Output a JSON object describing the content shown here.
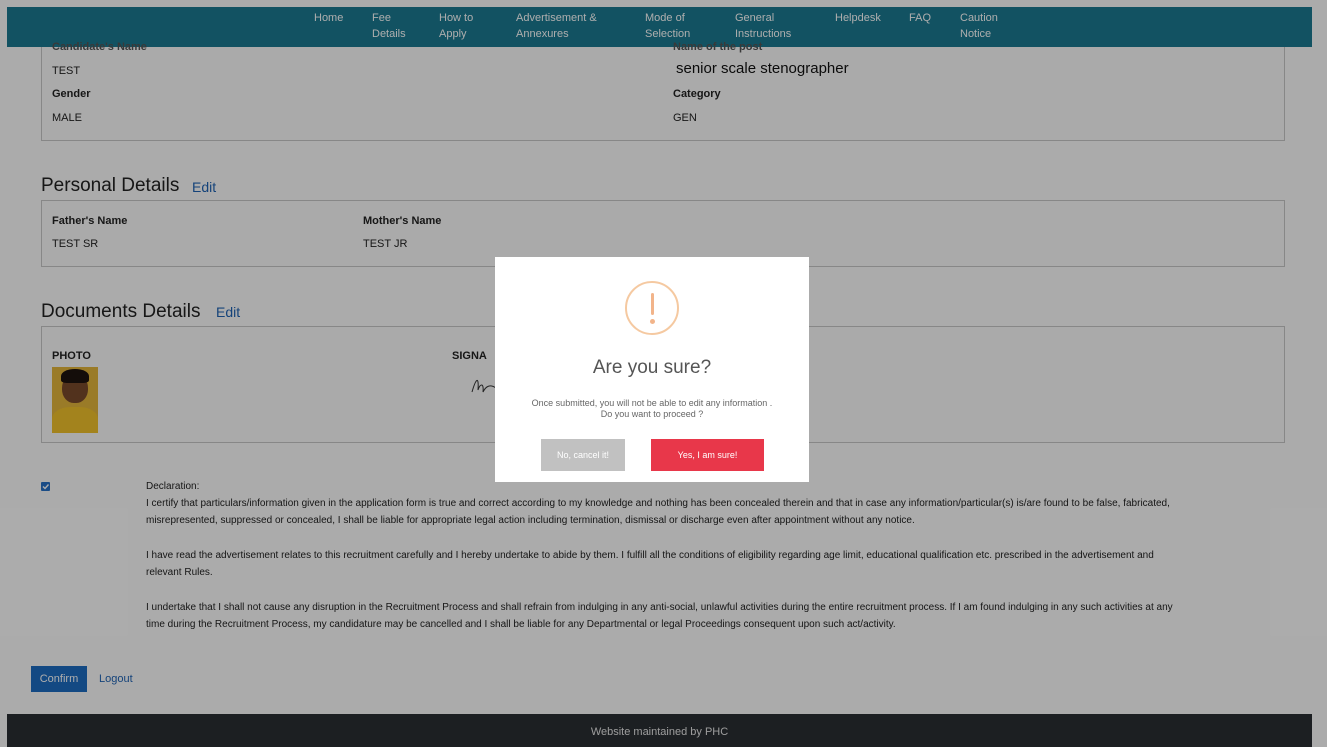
{
  "nav": {
    "items": [
      {
        "label": "Home"
      },
      {
        "label": "Fee\nDetails"
      },
      {
        "label": "How to\nApply"
      },
      {
        "label": "Advertisement &\nAnnexures"
      },
      {
        "label": "Mode of\nSelection"
      },
      {
        "label": "General\nInstructions"
      },
      {
        "label": "Helpdesk"
      },
      {
        "label": "FAQ"
      },
      {
        "label": "Caution\nNotice"
      }
    ]
  },
  "candidate": {
    "name_label": "Candidate's Name",
    "name_value": "TEST",
    "post_label": "Name of the post",
    "post_value": "senior scale stenographer",
    "gender_label": "Gender",
    "gender_value": "MALE",
    "category_label": "Category",
    "category_value": "GEN"
  },
  "personal": {
    "title": "Personal Details",
    "edit_label": "Edit",
    "father_label": "Father's Name",
    "father_value": "TEST SR",
    "mother_label": "Mother's Name",
    "mother_value": "TEST JR"
  },
  "documents": {
    "title": "Documents Details",
    "edit_label": "Edit",
    "photo_label": "PHOTO",
    "signature_label": "SIGNA"
  },
  "declaration": {
    "checked": true,
    "heading": "Declaration:",
    "p1": "I certify that particulars/information given in the application form is true and correct according to my knowledge and nothing has been concealed therein and that in case any information/particular(s) is/are found to be false, fabricated, misrepresented, suppressed or concealed, I shall be liable for appropriate legal action including termination, dismissal or discharge even after appointment without any notice.",
    "p2": "I have read the advertisement relates to this recruitment carefully and I hereby undertake to abide by them. I fulfill all the conditions of eligibility regarding age limit, educational qualification etc. prescribed in the advertisement and relevant Rules.",
    "p3": "I undertake that I shall not cause any disruption in the Recruitment Process and shall refrain from indulging in any anti-social, unlawful activities during the entire recruitment process. If I am found indulging in any such activities at any time during the Recruitment Process, my candidature may be cancelled and I shall be liable for any Departmental or legal Proceedings consequent upon such act/activity."
  },
  "actions": {
    "confirm_label": "Confirm",
    "logout_label": "Logout"
  },
  "footer": {
    "text": "Website maintained by PHC"
  },
  "modal": {
    "title": "Are you sure?",
    "text_line1": "Once submitted, you will not be able to edit any information .",
    "text_line2": "Do you want to proceed ?",
    "cancel_label": "No, cancel it!",
    "confirm_label": "Yes, I am sure!",
    "icon": "warning-icon",
    "accent_color": "#e8374a",
    "icon_color": "#f2b48a"
  }
}
